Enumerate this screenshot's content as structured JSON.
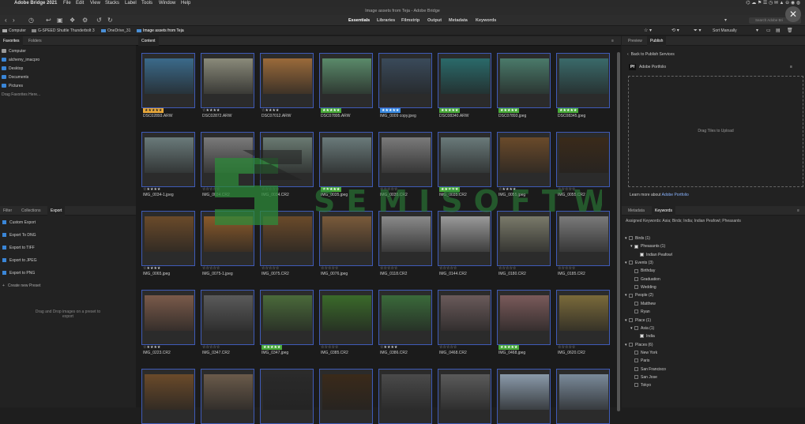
{
  "menubar": {
    "apple": "",
    "app_name": "Adobe Bridge 2021",
    "items": [
      "File",
      "Edit",
      "View",
      "Stacks",
      "Label",
      "Tools",
      "Window",
      "Help"
    ],
    "status": "⌬ ☁ ⚑ ☰ ◷ ✉ ▲ ⊖ ◉ ◍"
  },
  "window": {
    "title": "Image assets from Teja - Adobe Bridge"
  },
  "toolbar": {
    "workspaces": [
      "Essentials",
      "Libraries",
      "Filmstrip",
      "Output",
      "Metadata",
      "Keywords"
    ],
    "active_workspace": "Essentials",
    "sort_label": "Sort Manually",
    "search_placeholder": "Search Adobe Bri"
  },
  "path": {
    "crumbs": [
      "Computer",
      "G-SPEED Shuttle Thunderbolt 3",
      "OneDrive_31",
      "Image assets from Teja"
    ]
  },
  "left_top": {
    "tabs": [
      "Favorites",
      "Folders"
    ],
    "favorites": [
      "Computer",
      "alchemy_imacpro",
      "Desktop",
      "Documents",
      "Pictures"
    ],
    "drag_hint": "Drag Favorites Here..."
  },
  "left_bottom": {
    "tabs": [
      "Filter",
      "Collections",
      "Export"
    ],
    "presets": [
      "Custom Export",
      "Export To DNG",
      "Export to TIFF",
      "Export to JPEG",
      "Export to PNG"
    ],
    "create_preset": "Create new Preset",
    "drop_hint": "Drag and Drop images on a preset to export"
  },
  "content": {
    "tab": "Content",
    "items": [
      {
        "name": "DSC02893.ARW",
        "stars": "★★★★★",
        "style": "orange",
        "color": "#3b6a8a"
      },
      {
        "name": "DSC02872.ARW",
        "stars": "☆★★★★",
        "style": "",
        "color": "#8a8a7a"
      },
      {
        "name": "DSC07012.ARW",
        "stars": "☆★★★★",
        "style": "",
        "color": "#9a6a3a"
      },
      {
        "name": "DSC07895.ARW",
        "stars": "★★★★★",
        "style": "green",
        "color": "#5a8a6a"
      },
      {
        "name": "IMG_0009 copy.jpeg",
        "stars": "★★★★★",
        "style": "blue",
        "color": "#3a4a5a"
      },
      {
        "name": "DSC08340.ARW",
        "stars": "★★★★★",
        "style": "green",
        "color": "#2a6a6a"
      },
      {
        "name": "DSC07893.jpeg",
        "stars": "★★★★★",
        "style": "green",
        "color": "#4a7a6a"
      },
      {
        "name": "DSC08345.jpeg",
        "stars": "★★★★★",
        "style": "green",
        "color": "#3a6a6a"
      },
      {
        "name": "IMG_0034-1.jpeg",
        "stars": "☆★★★★",
        "style": "",
        "color": "#6a7a7a"
      },
      {
        "name": "IMG_0034.CR2",
        "stars": "☆☆☆☆☆",
        "style": "",
        "color": "#7a7a7a"
      },
      {
        "name": "IMG_0034.CR2",
        "stars": "☆☆☆☆☆",
        "style": "",
        "color": "#6a7a72"
      },
      {
        "name": "IMG_0035.jpeg",
        "stars": "★★★★★",
        "style": "green",
        "color": "#6a7a7a"
      },
      {
        "name": "IMG_0035.CR2",
        "stars": "☆☆☆☆☆",
        "style": "",
        "color": "#7a7a7a"
      },
      {
        "name": "IMG_0035.CR2",
        "stars": "★★★★★",
        "style": "green",
        "color": "#6a7a7a"
      },
      {
        "name": "IMG_0055.jpeg",
        "stars": "☆★★★★",
        "style": "",
        "color": "#6a4a2a"
      },
      {
        "name": "IMG_0055.CR2",
        "stars": "☆☆☆☆☆",
        "style": "",
        "color": "#3a2a1a"
      },
      {
        "name": "IMG_0065.jpeg",
        "stars": "☆★★★★",
        "style": "",
        "color": "#6a4a2a"
      },
      {
        "name": "IMG_0075-1.jpeg",
        "stars": "☆☆☆☆☆",
        "style": "",
        "color": "#8a5a2a"
      },
      {
        "name": "IMG_0075.CR2",
        "stars": "☆☆☆☆☆",
        "style": "",
        "color": "#6a4a2a"
      },
      {
        "name": "IMG_0076.jpeg",
        "stars": "☆☆☆☆☆",
        "style": "",
        "color": "#7a5a3a"
      },
      {
        "name": "IMG_0118.CR2",
        "stars": "☆☆☆☆☆",
        "style": "",
        "color": "#8a8a8a"
      },
      {
        "name": "IMG_0144.CR2",
        "stars": "☆☆☆☆☆",
        "style": "",
        "color": "#9a9a9a"
      },
      {
        "name": "IMG_0180.CR2",
        "stars": "☆☆☆☆☆",
        "style": "",
        "color": "#7a7a6a"
      },
      {
        "name": "IMG_0185.CR2",
        "stars": "☆☆☆☆☆",
        "style": "",
        "color": "#7a7a7a"
      },
      {
        "name": "IMG_0223.CR2",
        "stars": "☆★★★★",
        "style": "",
        "color": "#7a5a4a"
      },
      {
        "name": "IMG_0347.CR2",
        "stars": "☆☆☆☆☆",
        "style": "",
        "color": "#5a5a5a"
      },
      {
        "name": "IMG_0347.jpeg",
        "stars": "★★★★★",
        "style": "green",
        "color": "#4a6a3a"
      },
      {
        "name": "IMG_0385.CR2",
        "stars": "☆☆☆☆☆",
        "style": "",
        "color": "#3a6a2a"
      },
      {
        "name": "IMG_0386.CR2",
        "stars": "☆★★★★",
        "style": "",
        "color": "#3a6a3a"
      },
      {
        "name": "IMG_0468.CR2",
        "stars": "☆☆☆☆☆",
        "style": "",
        "color": "#6a5a5a"
      },
      {
        "name": "IMG_0468.jpeg",
        "stars": "★★★★★",
        "style": "green",
        "color": "#7a5a5a"
      },
      {
        "name": "IMG_0620.CR2",
        "stars": "☆☆☆☆☆",
        "style": "",
        "color": "#7a6a3a"
      },
      {
        "name": "",
        "stars": "",
        "style": "",
        "color": "#6a4a2a"
      },
      {
        "name": "",
        "stars": "",
        "style": "",
        "color": "#6a5a4a"
      },
      {
        "name": "",
        "stars": "",
        "style": "",
        "color": "#2a2a2a"
      },
      {
        "name": "",
        "stars": "",
        "style": "",
        "color": "#3a2a1a"
      },
      {
        "name": "",
        "stars": "",
        "style": "",
        "color": "#4a4a4a"
      },
      {
        "name": "",
        "stars": "",
        "style": "",
        "color": "#5a5a5a"
      },
      {
        "name": "",
        "stars": "",
        "style": "",
        "color": "#8a9aaa"
      },
      {
        "name": "",
        "stars": "",
        "style": "",
        "color": "#7a8a9a"
      }
    ]
  },
  "right_top": {
    "tabs": [
      "Preview",
      "Publish"
    ],
    "back_label": "Back to Publish Services",
    "service_badge": "Pf",
    "service_name": "Adobe Portfolio",
    "drag_tiles": "Drag Tiles to Upload",
    "learn_more_prefix": "Learn more about",
    "learn_more_link": "Adobe Portfolio"
  },
  "right_bottom": {
    "tabs": [
      "Metadata",
      "Keywords"
    ],
    "assigned": "Assigned Keywords: Asia; Birds; India; Indian Peafowl; Pheasants",
    "keywords": [
      {
        "label": "Birds (1)",
        "level": 0,
        "checked": false,
        "arrow": "▾"
      },
      {
        "label": "Pheasants (1)",
        "level": 1,
        "checked": true,
        "arrow": "▾"
      },
      {
        "label": "Indian Peafowl",
        "level": 2,
        "checked": true,
        "arrow": ""
      },
      {
        "label": "Events (3)",
        "level": 0,
        "checked": false,
        "arrow": "▾"
      },
      {
        "label": "Birthday",
        "level": 1,
        "checked": false,
        "arrow": ""
      },
      {
        "label": "Graduation",
        "level": 1,
        "checked": false,
        "arrow": ""
      },
      {
        "label": "Wedding",
        "level": 1,
        "checked": false,
        "arrow": ""
      },
      {
        "label": "People (2)",
        "level": 0,
        "checked": false,
        "arrow": "▾"
      },
      {
        "label": "Matthew",
        "level": 1,
        "checked": false,
        "arrow": ""
      },
      {
        "label": "Ryan",
        "level": 1,
        "checked": false,
        "arrow": ""
      },
      {
        "label": "Place (1)",
        "level": 0,
        "checked": false,
        "arrow": "▾"
      },
      {
        "label": "Asia (1)",
        "level": 1,
        "checked": false,
        "arrow": "▾"
      },
      {
        "label": "India",
        "level": 2,
        "checked": true,
        "arrow": ""
      },
      {
        "label": "Places (6)",
        "level": 0,
        "checked": false,
        "arrow": "▾"
      },
      {
        "label": "New York",
        "level": 1,
        "checked": false,
        "arrow": ""
      },
      {
        "label": "Paris",
        "level": 1,
        "checked": false,
        "arrow": ""
      },
      {
        "label": "San Francisco",
        "level": 1,
        "checked": false,
        "arrow": ""
      },
      {
        "label": "San Jose",
        "level": 1,
        "checked": false,
        "arrow": ""
      },
      {
        "label": "Tokyo",
        "level": 1,
        "checked": false,
        "arrow": ""
      }
    ]
  },
  "watermark": {
    "text": "SEMISOFTWARES"
  },
  "close_button": "✕"
}
